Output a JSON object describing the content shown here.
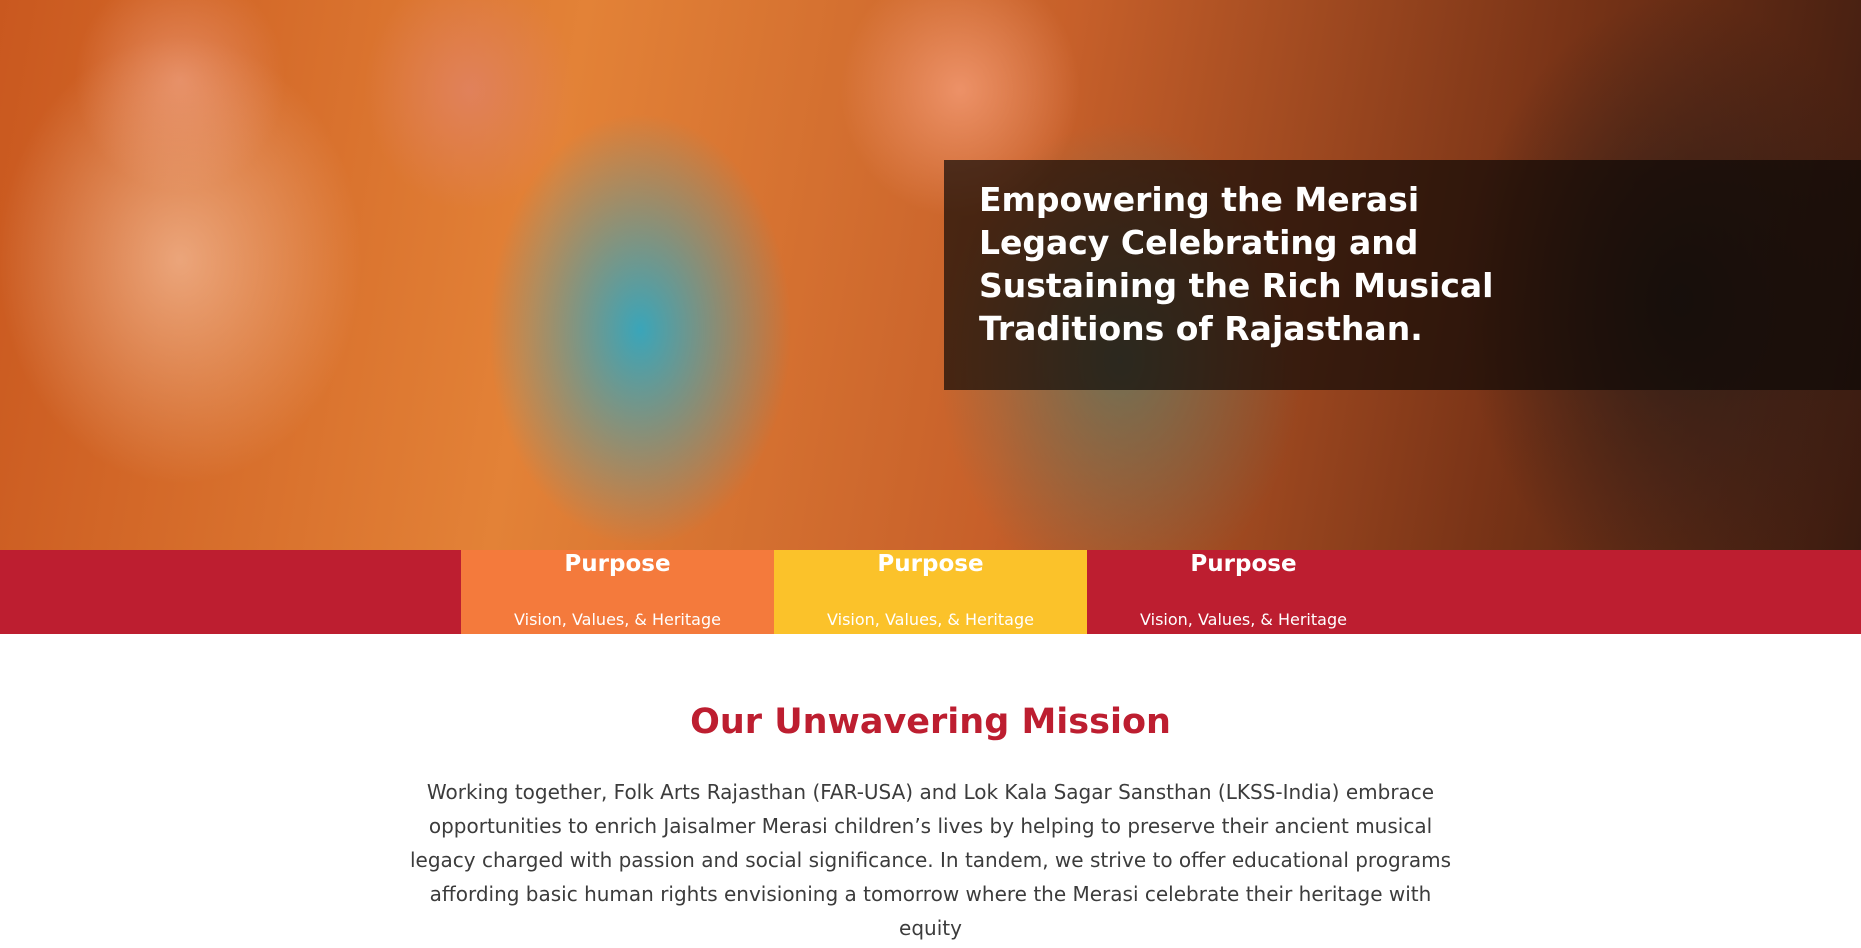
{
  "hero": {
    "title": "Empowering the Merasi Legacy Celebrating and Sustaining the Rich Musical Traditions of Rajasthan."
  },
  "cards": [
    {
      "title": "Purpose",
      "subtitle": "Vision, Values, & Heritage",
      "color": "#f47a3c"
    },
    {
      "title": "Purpose",
      "subtitle": "Vision, Values, & Heritage",
      "color": "#fbc22a"
    },
    {
      "title": "Purpose",
      "subtitle": "Vision, Values, & Heritage",
      "color": "#bd1e30"
    }
  ],
  "mission": {
    "heading": "Our Unwavering Mission",
    "body": "Working together, Folk Arts Rajasthan (FAR-USA) and Lok Kala Sagar Sansthan (LKSS-India) embrace opportunities to enrich Jaisalmer Merasi children’s lives by helping to preserve their ancient musical legacy charged with passion and social significance. In tandem, we strive to offer educational programs affording basic human rights envisioning a tomorrow where the Merasi celebrate their heritage with equity"
  },
  "colors": {
    "brand_red": "#bd1e30",
    "orange": "#f47a3c",
    "yellow": "#fbc22a"
  }
}
